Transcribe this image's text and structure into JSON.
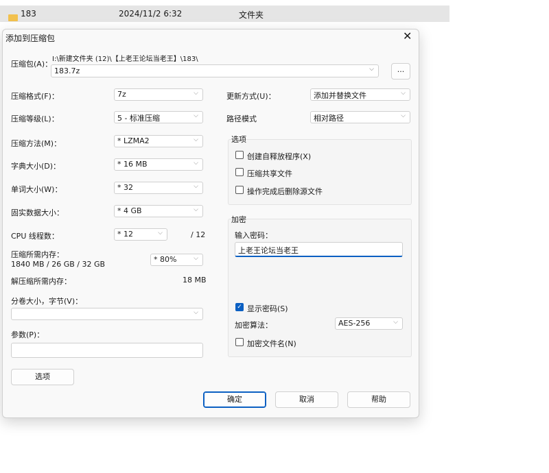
{
  "file_row": {
    "name": "183",
    "date": "2024/11/2 6:32",
    "type": "文件夹"
  },
  "dialog": {
    "title": "添加到压缩包",
    "archive_label": "压缩包(A)：",
    "archive_path": "I:\\新建文件夹 (12)\\【上老王论坛当老王】\\183\\",
    "archive_name": "183.7z",
    "browse": "...",
    "format_label": "压缩格式(F)：",
    "format": "7z",
    "level_label": "压缩等级(L)：",
    "level": "5 - 标准压缩",
    "method_label": "压缩方法(M)：",
    "method": "* LZMA2",
    "dict_label": "字典大小(D)：",
    "dict": "* 16 MB",
    "word_label": "单词大小(W)：",
    "word": "* 32",
    "solid_label": "固实数据大小：",
    "solid": "* 4 GB",
    "cpu_label": "CPU 线程数：",
    "cpu": "* 12",
    "cpu_max": "/ 12",
    "mem_label": "压缩所需内存：",
    "mem_value": "1840 MB / 26 GB / 32 GB",
    "mem_pct": "* 80%",
    "decomp_label": "解压缩所需内存：",
    "decomp_value": "18 MB",
    "split_label": "分卷大小，字节(V)：",
    "split": "",
    "params_label": "参数(P)：",
    "params": "",
    "options_button": "选项",
    "update_label": "更新方式(U)：",
    "update": "添加并替换文件",
    "path_label": "路径模式",
    "path": "相对路径",
    "options_group": "选项",
    "opt_sfx": "创建自释放程序(X)",
    "opt_shared": "压缩共享文件",
    "opt_delete": "操作完成后删除源文件",
    "enc_group": "加密",
    "pwd_label": "输入密码：",
    "pwd": "上老王论坛当老王",
    "show_pwd": "显示密码(S)",
    "enc_method_label": "加密算法：",
    "enc_method": "AES-256",
    "enc_names": "加密文件名(N)",
    "ok": "确定",
    "cancel": "取消",
    "help": "帮助"
  }
}
